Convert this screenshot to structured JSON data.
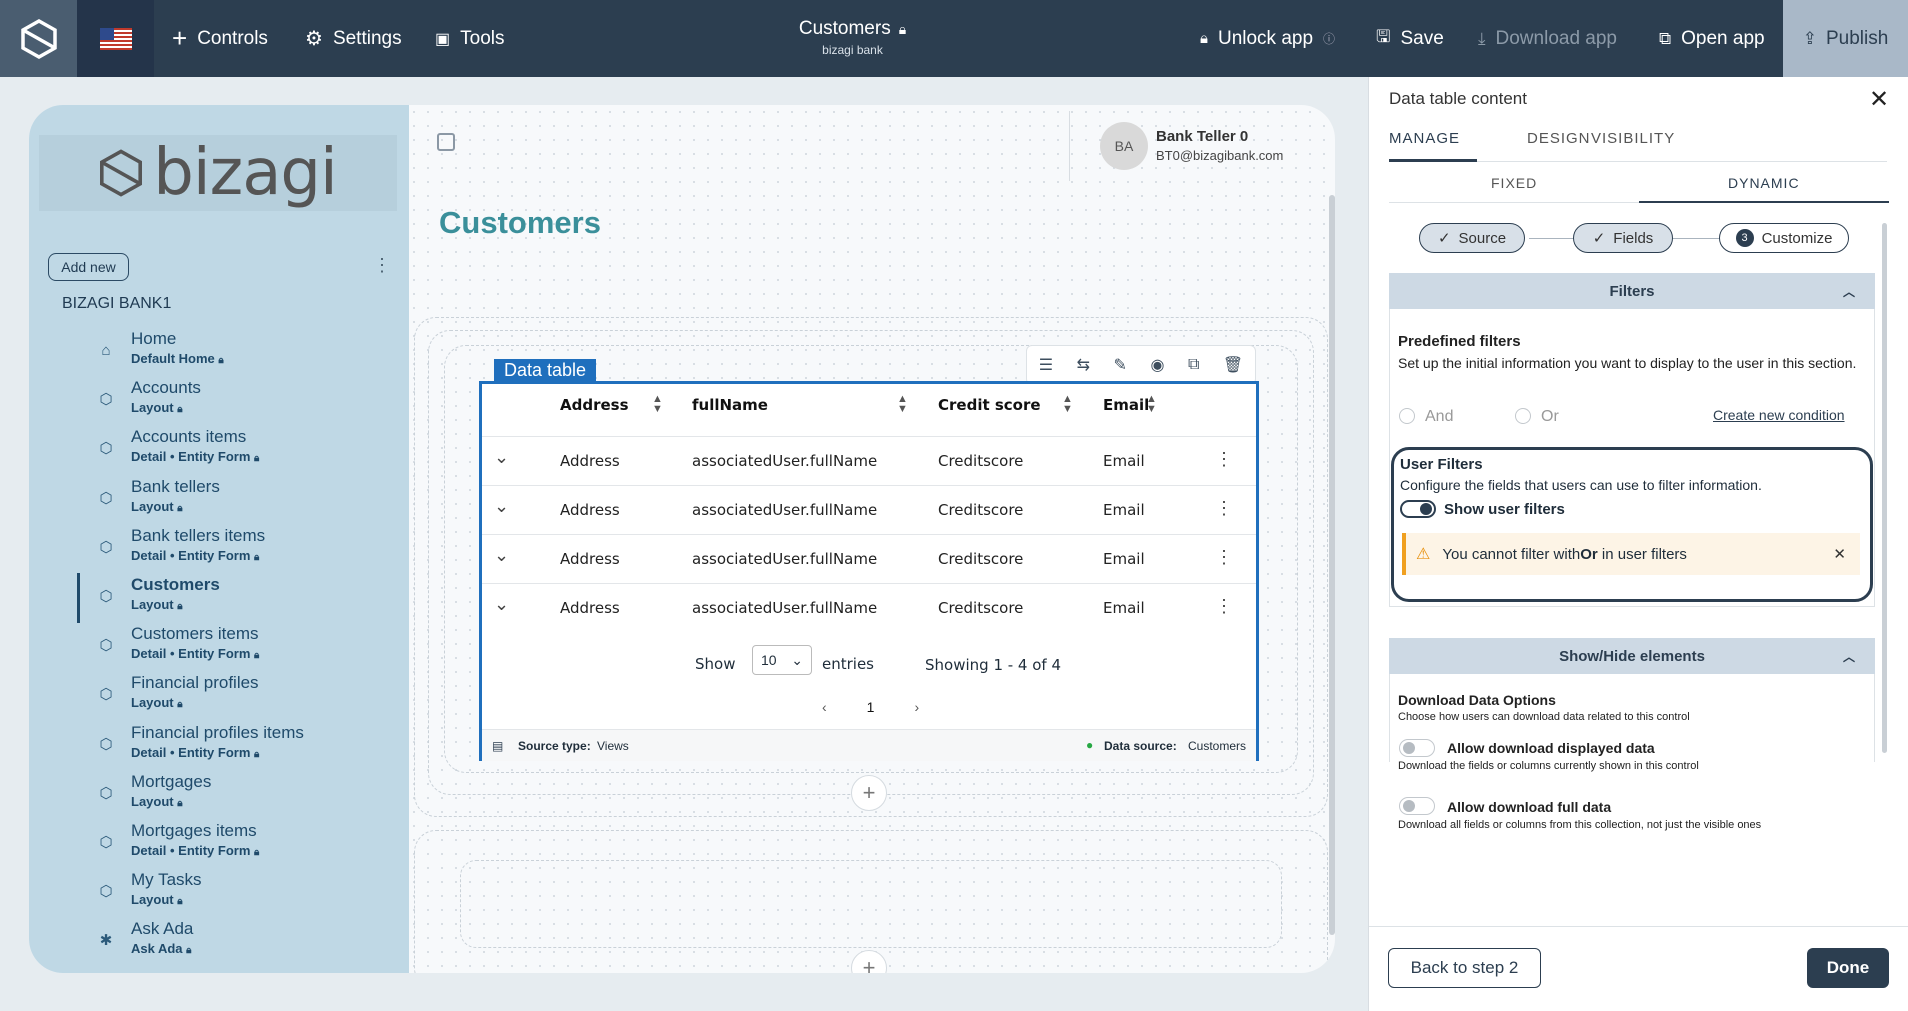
{
  "topbar": {
    "controls": "Controls",
    "settings": "Settings",
    "tools": "Tools",
    "title": "Customers",
    "subtitle": "bizagi bank",
    "unlock": "Unlock app",
    "save": "Save",
    "download": "Download app",
    "open": "Open app",
    "publish": "Publish"
  },
  "sidebar": {
    "logo_text": "bizagi",
    "add_new": "Add new",
    "group_title": "BIZAGI BANK1",
    "items": [
      {
        "label": "Home",
        "sub": "Default Home",
        "icon": "home-icon"
      },
      {
        "label": "Accounts",
        "sub": "Layout",
        "icon": "layout-icon"
      },
      {
        "label": "Accounts items",
        "sub": "Detail • Entity Form",
        "icon": "layout-icon"
      },
      {
        "label": "Bank tellers",
        "sub": "Layout",
        "icon": "layout-icon"
      },
      {
        "label": "Bank tellers items",
        "sub": "Detail • Entity Form",
        "icon": "layout-icon"
      },
      {
        "label": "Customers",
        "sub": "Layout",
        "icon": "layout-icon"
      },
      {
        "label": "Customers items",
        "sub": "Detail • Entity Form",
        "icon": "layout-icon"
      },
      {
        "label": "Financial profiles",
        "sub": "Layout",
        "icon": "layout-icon"
      },
      {
        "label": "Financial profiles items",
        "sub": "Detail • Entity Form",
        "icon": "layout-icon"
      },
      {
        "label": "Mortgages",
        "sub": "Layout",
        "icon": "layout-icon"
      },
      {
        "label": "Mortgages items",
        "sub": "Detail • Entity Form",
        "icon": "layout-icon"
      },
      {
        "label": "My Tasks",
        "sub": "Layout",
        "icon": "layout-icon"
      },
      {
        "label": "Ask Ada",
        "sub": "Ask Ada",
        "icon": "ada-icon"
      }
    ]
  },
  "user": {
    "initials": "BA",
    "name": "Bank Teller 0",
    "email": "BT0@bizagibank.com"
  },
  "page": {
    "title": "Customers"
  },
  "datatable": {
    "label": "Data table",
    "columns": [
      "Address",
      "fullName",
      "Credit score",
      "Email"
    ],
    "rows": [
      [
        "Address",
        "associatedUser.fullName",
        "Creditscore",
        "Email"
      ],
      [
        "Address",
        "associatedUser.fullName",
        "Creditscore",
        "Email"
      ],
      [
        "Address",
        "associatedUser.fullName",
        "Creditscore",
        "Email"
      ],
      [
        "Address",
        "associatedUser.fullName",
        "Creditscore",
        "Email"
      ]
    ],
    "show": "Show",
    "page_size": "10",
    "entries": "entries",
    "showing": "Showing 1 - 4 of 4",
    "page": "1",
    "source_type_label": "Source type:",
    "source_type": "Views",
    "data_source_label": "Data source:",
    "data_source": "Customers"
  },
  "panel": {
    "title": "Data table content",
    "tabs": [
      "MANAGE",
      "DESIGN",
      "VISIBILITY"
    ],
    "subtabs": [
      "FIXED",
      "DYNAMIC"
    ],
    "steps": [
      "Source",
      "Fields",
      "Customize"
    ],
    "step_num": "3",
    "filters_header": "Filters",
    "predef_title": "Predefined filters",
    "predef_desc": "Set up the initial information you want to display to the user in this section.",
    "and": "And",
    "or": "Or",
    "create_condition": "Create new condition",
    "uf_title": "User Filters",
    "uf_desc": "Configure the fields that users can use to filter information.",
    "uf_toggle": "Show user filters",
    "warn_pre": "You cannot filter with ",
    "warn_bold": "Or",
    "warn_post": " in user filters",
    "showhide_header": "Show/Hide elements",
    "dl_title": "Download Data Options",
    "dl_desc": "Choose how users can download data related to this control",
    "dl1_label": "Allow download displayed data",
    "dl1_desc": "Download the fields or columns currently shown in this control",
    "dl2_label": "Allow download full data",
    "dl2_desc": "Download all fields or columns from this collection, not just the visible ones",
    "back": "Back to step 2",
    "done": "Done"
  },
  "colors": {
    "topbar": "#2c3e50",
    "accent": "#1f6fbd",
    "sidebar": "#bfd8e5",
    "title": "#3a8f9a"
  }
}
